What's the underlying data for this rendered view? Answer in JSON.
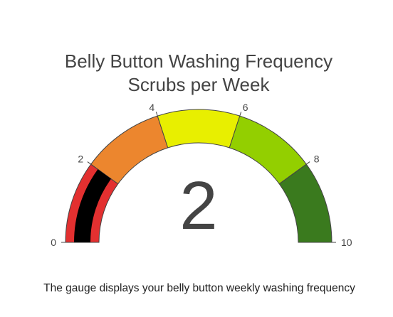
{
  "chart_data": {
    "type": "gauge",
    "title_lines": [
      "Belly Button Washing Frequency",
      "Scrubs per Week"
    ],
    "range": [
      0,
      10
    ],
    "value": 2,
    "value_label": "2",
    "tick_values": [
      0,
      2,
      4,
      6,
      8,
      10
    ],
    "tick_labels": [
      "0",
      "2",
      "4",
      "6",
      "8",
      "10"
    ],
    "steps": [
      {
        "range": [
          0,
          2
        ],
        "color": "#e33030"
      },
      {
        "range": [
          2,
          4
        ],
        "color": "#ec862e"
      },
      {
        "range": [
          4,
          6
        ],
        "color": "#e8ef00"
      },
      {
        "range": [
          6,
          8
        ],
        "color": "#93cf00"
      },
      {
        "range": [
          8,
          10
        ],
        "color": "#3a7a1e"
      }
    ],
    "bar_color": "#000000"
  },
  "caption": "The gauge displays your belly button weekly washing frequency"
}
